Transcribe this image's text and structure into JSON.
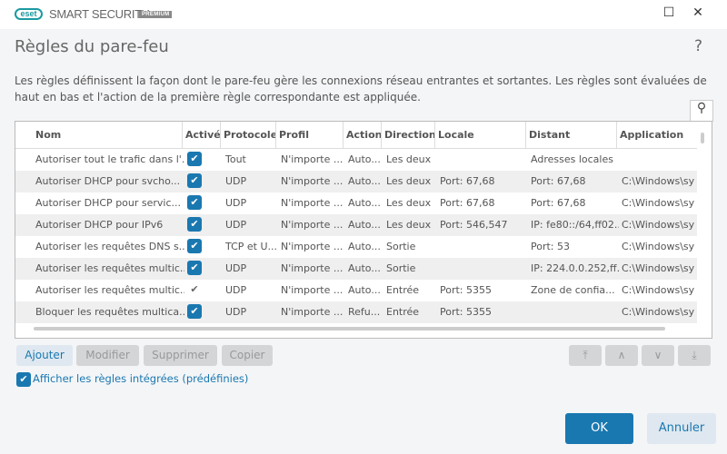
{
  "app": {
    "logo": "eset",
    "name": "SMART SECURITY",
    "edition": "PREMIUM"
  },
  "window": {
    "minimize": "—",
    "maximize": "☐",
    "close": "✕"
  },
  "title": "Règles du pare-feu",
  "help": "?",
  "description": "Les règles définissent la façon dont le pare-feu gère les connexions réseau entrantes et sortantes. Les règles sont évaluées de haut en bas et l'action de la première règle correspondante est appliquée.",
  "search_icon": "🔍",
  "columns": [
    "Nom",
    "Activé",
    "Protocole",
    "Profil",
    "Action",
    "Direction",
    "Locale",
    "Distant",
    "Application"
  ],
  "rows": [
    {
      "name": "Autoriser tout le trafic dans l'...",
      "enabled": true,
      "protocol": "Tout",
      "profile": "N'importe ...",
      "action": "Auto...",
      "direction": "Les deux",
      "local": "",
      "remote": "Adresses locales",
      "app": ""
    },
    {
      "name": "Autoriser DHCP pour svcho...",
      "enabled": true,
      "protocol": "UDP",
      "profile": "N'importe ...",
      "action": "Auto...",
      "direction": "Les deux",
      "local": "Port: 67,68",
      "remote": "Port: 67,68",
      "app": "C:\\Windows\\sy"
    },
    {
      "name": "Autoriser DHCP pour servic...",
      "enabled": true,
      "protocol": "UDP",
      "profile": "N'importe ...",
      "action": "Auto...",
      "direction": "Les deux",
      "local": "Port: 67,68",
      "remote": "Port: 67,68",
      "app": "C:\\Windows\\sy"
    },
    {
      "name": "Autoriser DHCP pour IPv6",
      "enabled": true,
      "protocol": "UDP",
      "profile": "N'importe ...",
      "action": "Auto...",
      "direction": "Les deux",
      "local": "Port: 546,547",
      "remote": "IP: fe80::/64,ff02...",
      "app": "C:\\Windows\\sy"
    },
    {
      "name": "Autoriser les requêtes DNS s...",
      "enabled": true,
      "protocol": "TCP et U...",
      "profile": "N'importe ...",
      "action": "Auto...",
      "direction": "Sortie",
      "local": "",
      "remote": "Port: 53",
      "app": "C:\\Windows\\sy"
    },
    {
      "name": "Autoriser les requêtes multic...",
      "enabled": true,
      "protocol": "UDP",
      "profile": "N'importe ...",
      "action": "Auto...",
      "direction": "Sortie",
      "local": "",
      "remote": "IP: 224.0.0.252,ff...",
      "app": "C:\\Windows\\sy"
    },
    {
      "name": "Autoriser les requêtes multic...",
      "enabled": false,
      "protocol": "UDP",
      "profile": "N'importe ...",
      "action": "Auto...",
      "direction": "Entrée",
      "local": "Port: 5355",
      "remote": "Zone de confia...",
      "app": "C:\\Windows\\sy"
    },
    {
      "name": "Bloquer les requêtes multica...",
      "enabled": true,
      "protocol": "UDP",
      "profile": "N'importe ...",
      "action": "Refu...",
      "direction": "Entrée",
      "local": "Port: 5355",
      "remote": "",
      "app": "C:\\Windows\\sy"
    }
  ],
  "buttons": {
    "add": "Ajouter",
    "edit": "Modifier",
    "delete": "Supprimer",
    "copy": "Copier",
    "top": "⤒",
    "up": "∧",
    "down": "∨",
    "bottom": "⤓"
  },
  "show_builtin": {
    "label": "Afficher les règles intégrées (prédéfinies)",
    "checked": true
  },
  "ok": "OK",
  "cancel": "Annuler",
  "colors": {
    "accent": "#1a78b0",
    "brand": "#1a9aa0"
  }
}
